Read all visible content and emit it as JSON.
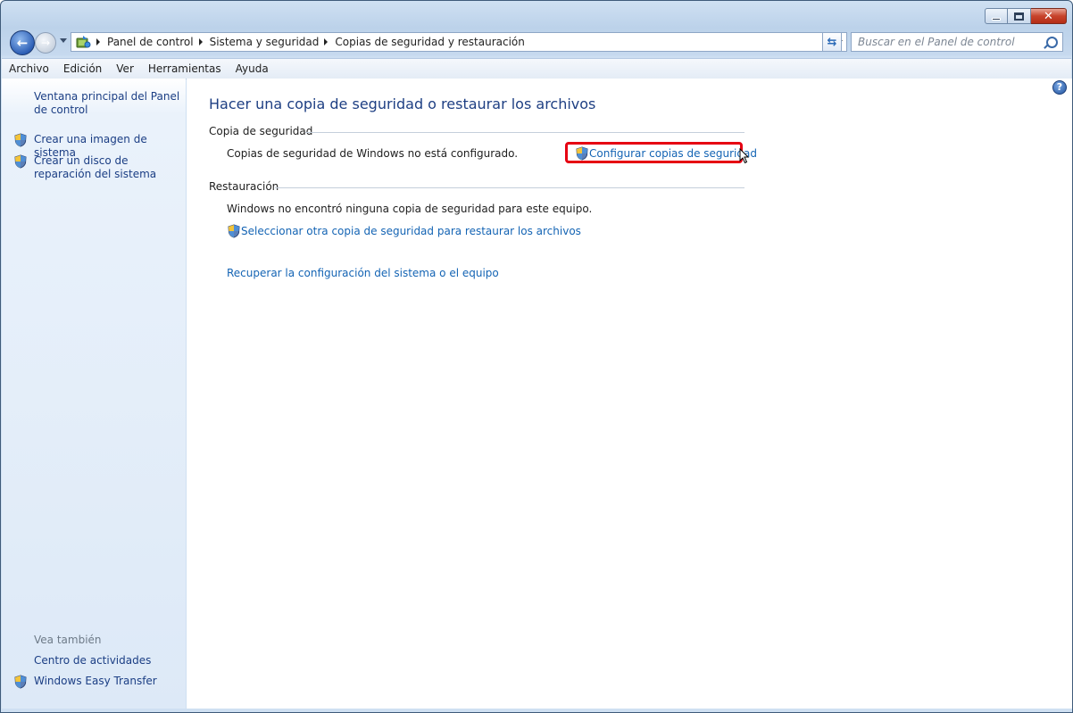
{
  "window": {
    "close_glyph": "✕"
  },
  "navigation": {
    "breadcrumbs": [
      "Panel de control",
      "Sistema y seguridad",
      "Copias de seguridad y restauración"
    ],
    "search_placeholder": "Buscar en el Panel de control"
  },
  "menu": {
    "items": [
      "Archivo",
      "Edición",
      "Ver",
      "Herramientas",
      "Ayuda"
    ]
  },
  "sidebar": {
    "home_link": "Ventana principal del Panel de control",
    "tasks": [
      "Crear una imagen de sistema",
      "Crear un disco de reparación del sistema"
    ],
    "see_also_label": "Vea también",
    "see_also": [
      "Centro de actividades",
      "Windows Easy Transfer"
    ]
  },
  "main": {
    "title": "Hacer una copia de seguridad o restaurar los archivos",
    "backup": {
      "heading": "Copia de seguridad",
      "status": "Copias de seguridad de Windows no está configurado.",
      "action": "Configurar copias de seguridad"
    },
    "restore": {
      "heading": "Restauración",
      "status": "Windows no encontró ninguna copia de seguridad para este equipo.",
      "select_other": "Seleccionar otra copia de seguridad para restaurar los archivos",
      "recover": "Recuperar la configuración del sistema o el equipo"
    },
    "help_glyph": "?"
  },
  "colors": {
    "link": "#1464b4",
    "title": "#1e3f83",
    "highlight": "#e60012"
  },
  "icons": [
    "back-icon",
    "forward-icon",
    "control-panel-icon",
    "refresh-icon",
    "search-icon",
    "shield-icon",
    "help-icon",
    "cursor-icon"
  ]
}
